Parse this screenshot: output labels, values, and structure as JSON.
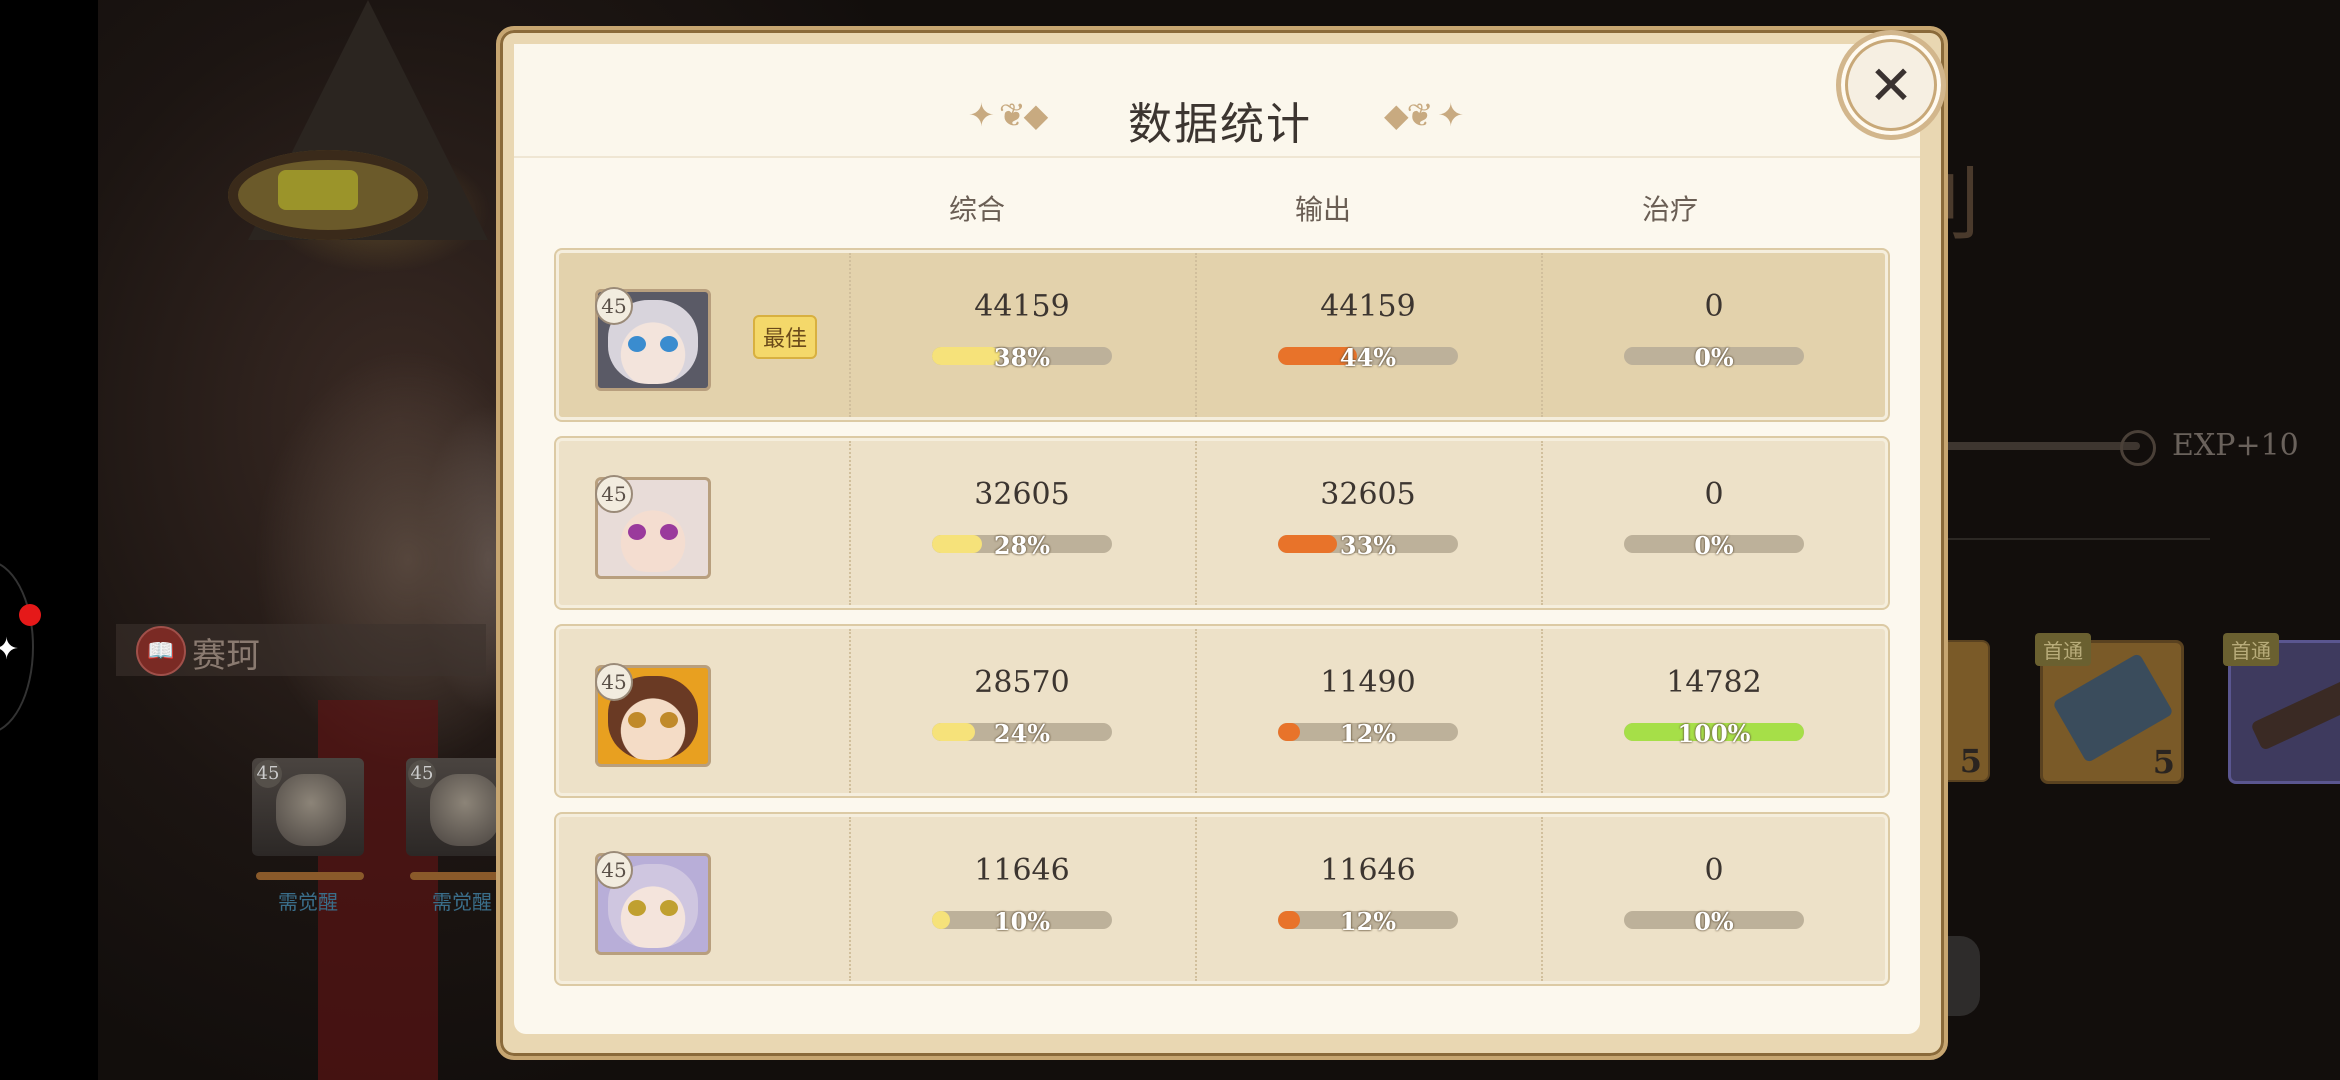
{
  "modal": {
    "title": "数据统计",
    "close_icon": "close-x-icon",
    "columns": [
      "综合",
      "输出",
      "治疗"
    ],
    "best_label": "最佳",
    "rows": [
      {
        "level": "45",
        "best": true,
        "avatar": {
          "hair": "#d8d4dc",
          "skin": "#f3e4dc",
          "eye": "#3a8ccf",
          "hat": "#5a5a66"
        },
        "overall": {
          "value": "44159",
          "pct_label": "38%",
          "pct": 38
        },
        "damage": {
          "value": "44159",
          "pct_label": "44%",
          "pct": 44
        },
        "heal": {
          "value": "0",
          "pct_label": "0%",
          "pct": 0
        }
      },
      {
        "level": "45",
        "best": false,
        "avatar": {
          "hair": "#e8dcd8",
          "skin": "#f4ddd0",
          "eye": "#9a3a9c",
          "hat": "#e8dcd8"
        },
        "overall": {
          "value": "32605",
          "pct_label": "28%",
          "pct": 28
        },
        "damage": {
          "value": "32605",
          "pct_label": "33%",
          "pct": 33
        },
        "heal": {
          "value": "0",
          "pct_label": "0%",
          "pct": 0
        }
      },
      {
        "level": "45",
        "best": false,
        "avatar": {
          "hair": "#6a3a24",
          "skin": "#f4dcc6",
          "eye": "#c08a2a",
          "hat": "#e8a020"
        },
        "overall": {
          "value": "28570",
          "pct_label": "24%",
          "pct": 24
        },
        "damage": {
          "value": "11490",
          "pct_label": "12%",
          "pct": 12
        },
        "heal": {
          "value": "14782",
          "pct_label": "100%",
          "pct": 100
        }
      },
      {
        "level": "45",
        "best": false,
        "avatar": {
          "hair": "#cfc6e0",
          "skin": "#f4e4dc",
          "eye": "#c0a030",
          "hat": "#b8aed8"
        },
        "overall": {
          "value": "11646",
          "pct_label": "10%",
          "pct": 10
        },
        "damage": {
          "value": "11646",
          "pct_label": "12%",
          "pct": 12
        },
        "heal": {
          "value": "0",
          "pct_label": "0%",
          "pct": 0
        }
      }
    ]
  },
  "colors": {
    "overall_fill": "#f6e27a",
    "damage_fill": "#e8732a",
    "heal_fill": "#a6df48"
  },
  "background": {
    "book_icon": "book-icon",
    "tag_name": "赛珂",
    "mini_cards": [
      {
        "level": "45",
        "label": "需觉醒"
      },
      {
        "level": "45",
        "label": "需觉醒"
      }
    ],
    "title_fragment": "利",
    "exp_text": "EXP+10",
    "rewards": [
      {
        "badge": "",
        "count": "5"
      },
      {
        "badge": "首通",
        "count": "5"
      },
      {
        "badge": "首通",
        "count": ""
      }
    ]
  }
}
